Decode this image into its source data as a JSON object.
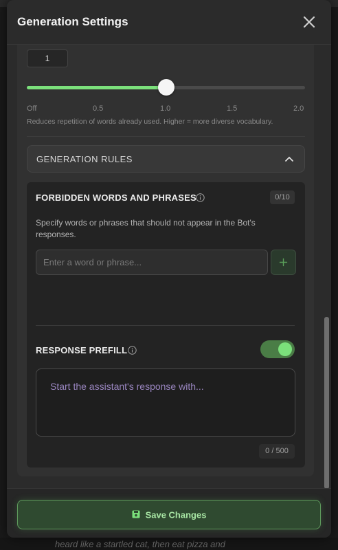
{
  "dialog": {
    "title": "Generation Settings"
  },
  "repetition": {
    "value_display": "1",
    "slider_value": 1.0,
    "slider_min": 0,
    "slider_max": 2.0,
    "ticks": [
      "Off",
      "0.5",
      "1.0",
      "1.5",
      "2.0"
    ],
    "helper": "Reduces repetition of words already used. Higher = more diverse vocabulary."
  },
  "rules": {
    "header": "GENERATION RULES",
    "forbidden": {
      "title": "FORBIDDEN WORDS AND PHRASES",
      "count": "0/10",
      "description": "Specify words or phrases that should not appear in the Bot's responses.",
      "input_placeholder": "Enter a word or phrase...",
      "add_label": "+"
    },
    "prefill": {
      "title": "RESPONSE PREFILL",
      "enabled": true,
      "placeholder": "Start the assistant's response with...",
      "char_count": "0 / 500"
    }
  },
  "footer": {
    "save_label": "Save Changes"
  },
  "background": {
    "text": "heard like a startled cat, then eat pizza and"
  },
  "colors": {
    "accent": "#7be07b",
    "save_bg": "#2f4a30",
    "save_text": "#a8e6a4",
    "placeholder_purple": "#9a86c0"
  }
}
